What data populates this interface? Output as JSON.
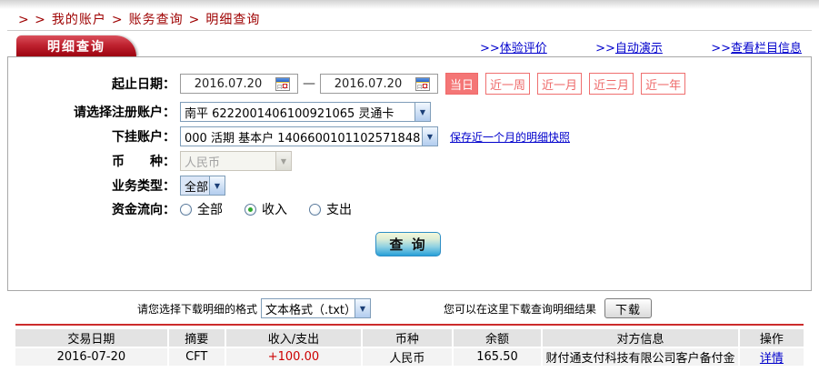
{
  "breadcrumb": {
    "prefix": "> >",
    "separator": ">",
    "items": [
      "我的账户",
      "账务查询",
      "明细查询"
    ]
  },
  "header": {
    "tab_title": "明细查询",
    "links": [
      {
        "prefix": ">>",
        "label": "体验评价"
      },
      {
        "prefix": ">>",
        "label": "自动演示"
      },
      {
        "prefix": ">>",
        "label": "查看栏目信息"
      }
    ]
  },
  "form": {
    "date_range": {
      "label": "起止日期：",
      "start_value": "2016.07.20",
      "end_value": "2016.07.20",
      "separator": "—",
      "quick_buttons": [
        {
          "label": "当日"
        },
        {
          "label": "近一周"
        },
        {
          "label": "近一月"
        },
        {
          "label": "近三月"
        },
        {
          "label": "近一年"
        }
      ],
      "active_quick_button": "当日"
    },
    "registered_account": {
      "label": "请选择注册账户：",
      "value": "南平 6222001406100921065 灵通卡"
    },
    "sub_account": {
      "label": "下挂账户：",
      "value": "000 活期 基本户 1406600101102571848",
      "snapshot_link": "保存近一个月的明细快照"
    },
    "currency": {
      "label": "币　　种：",
      "value": "人民币",
      "disabled": true
    },
    "business_type": {
      "label": "业务类型：",
      "value": "全部"
    },
    "fund_flow": {
      "label": "资金流向：",
      "options": [
        {
          "label": "全部",
          "checked": false
        },
        {
          "label": "收入",
          "checked": true
        },
        {
          "label": "支出",
          "checked": false
        }
      ]
    },
    "query_button": "查 询"
  },
  "download": {
    "format_label": "请您选择下载明细的格式",
    "format_value": "文本格式（.txt）",
    "hint": "您可以在这里下载查询明细结果",
    "button_label": "下载"
  },
  "table": {
    "headers": [
      "交易日期",
      "摘要",
      "收入/支出",
      "币种",
      "余额",
      "对方信息",
      "操作"
    ],
    "rows": [
      {
        "date": "2016-07-20",
        "summary": "CFT",
        "amount": "+100.00",
        "currency": "人民币",
        "balance": "165.50",
        "counterparty": "财付通支付科技有限公司客户备付金",
        "action": "详情"
      }
    ]
  },
  "icons": {
    "dropdown_arrow": "▼"
  },
  "colors": {
    "brand_red": "#a50010",
    "breadcrumb_red": "#9e0000",
    "quick_button_red": "#f47676",
    "link_blue": "#0000cc",
    "amount_red": "#cc0000",
    "select_border_blue": "#7f9db9",
    "table_header_bg": "#e3e3e3",
    "table_row_bg": "#f3f3f3",
    "table_divider_red": "#cc2b2b"
  }
}
